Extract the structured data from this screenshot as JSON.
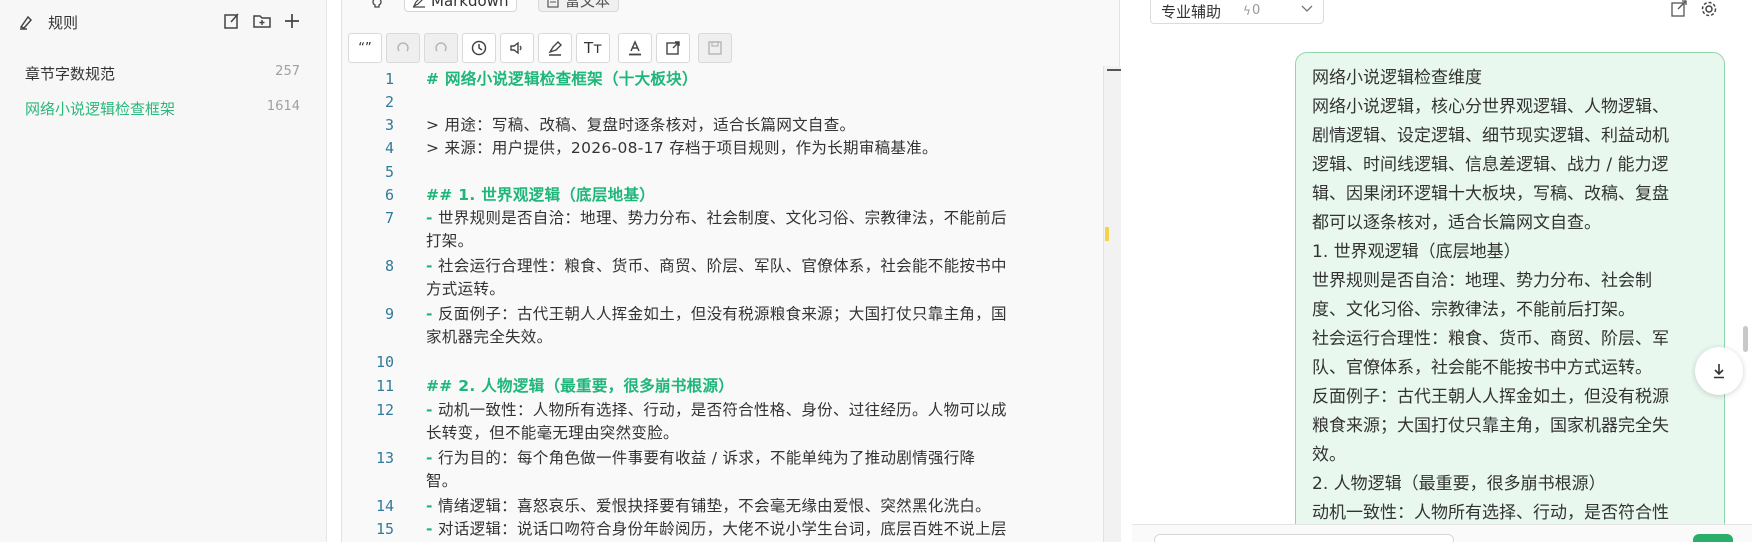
{
  "sidebar": {
    "title": "规则",
    "items": [
      {
        "name": "章节字数规范",
        "count": "257"
      },
      {
        "name": "网络小说逻辑检查框架",
        "count": "1614"
      }
    ],
    "actions": [
      "new-file-icon",
      "new-folder-icon",
      "add-icon"
    ]
  },
  "editor": {
    "tabs": {
      "markdown": "Markdown",
      "rich": "富文本"
    },
    "toolbar": {
      "quote": "“”",
      "format": "Tт"
    },
    "lines": [
      {
        "n": "1",
        "t": "# 网络小说逻辑检查框架（十大板块）"
      },
      {
        "n": "2",
        "t": ""
      },
      {
        "n": "3",
        "t": "> 用途：写稿、改稿、复盘时逐条核对，适合长篇网文自查。"
      },
      {
        "n": "4",
        "t": "> 来源：用户提供，2026-08-17 存档于项目规则，作为长期审稿基准。"
      },
      {
        "n": "5",
        "t": ""
      },
      {
        "n": "6",
        "t": "## 1. 世界观逻辑（底层地基）"
      },
      {
        "n": "7",
        "a": "世界规则是否自洽：地理、势力分布、社会制度、文化习俗、宗教律法，不能前后",
        "b": "打架。"
      },
      {
        "n": "8",
        "a": "社会运行合理性：粮食、货币、商贸、阶层、军队、官僚体系，社会能不能按书中",
        "b": "方式运转。"
      },
      {
        "n": "9",
        "a": "反面例子：古代王朝人人挥金如土，但没有税源粮食来源；大国打仗只靠主角，国",
        "b": "家机器完全失效。"
      },
      {
        "n": "10",
        "t": ""
      },
      {
        "n": "11",
        "t": "## 2. 人物逻辑（最重要，很多崩书根源）"
      },
      {
        "n": "12",
        "a": "动机一致性：人物所有选择、行动，是否符合性格、身份、过往经历。人物可以成",
        "b": "长转变，但不能毫无理由突然变脸。"
      },
      {
        "n": "13",
        "a": "行为目的：每个角色做一件事要有收益 / 诉求，不能单纯为了推动剧情强行降",
        "b": "智。"
      },
      {
        "n": "14",
        "a": "情绪逻辑：喜怒哀乐、爱恨抉择要有铺垫，不会毫无缘由爱恨、突然黑化洗白。"
      },
      {
        "n": "15",
        "a": "对话逻辑：说话口吻符合身份年龄阅历，大佬不说小学生台词，底层百姓不说上层"
      }
    ]
  },
  "chat": {
    "mode_label": "专业辅助",
    "mode_count": "0",
    "message": [
      "网络小说逻辑检查维度",
      "网络小说逻辑，核心分世界观逻辑、人物逻辑、",
      "剧情逻辑、设定逻辑、细节现实逻辑、利益动机",
      "逻辑、时间线逻辑、信息差逻辑、战力 / 能力逻",
      "辑、因果闭环逻辑十大板块，写稿、改稿、复盘",
      "都可以逐条核对，适合长篇网文自查。",
      "1. 世界观逻辑（底层地基）",
      "世界规则是否自洽：地理、势力分布、社会制",
      "度、文化习俗、宗教律法，不能前后打架。",
      "社会运行合理性：粮食、货币、商贸、阶层、军",
      "队、官僚体系，社会能不能按书中方式运转。",
      "反面例子：古代王朝人人挥金如土，但没有税源",
      "粮食来源；大国打仗只靠主角，国家机器完全失",
      "效。",
      "2. 人物逻辑（最重要，很多崩书根源）",
      "动机一致性：人物所有选择、行动，是否符合性"
    ]
  }
}
